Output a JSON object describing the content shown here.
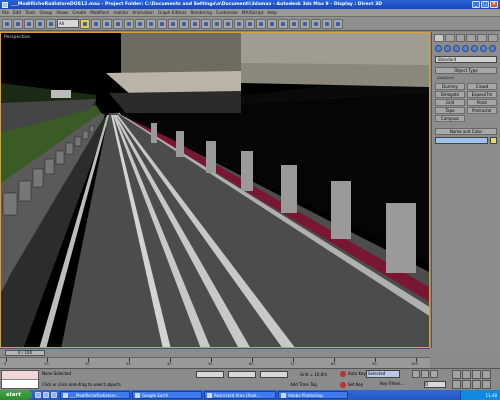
{
  "window": {
    "title": "___ModifiicheRadiatoreDOS12.max - Project Folder: C:\\Documents and Settings\\a\\Documenti\\3dsmax - Autodesk 3ds Max 9 - Display : Direct 3D",
    "buttons": {
      "minimize": "_",
      "maximize": "□",
      "close": "×"
    }
  },
  "menu": [
    "File",
    "Edit",
    "Tools",
    "Group",
    "Views",
    "Create",
    "Modifiers",
    "reactor",
    "Animation",
    "Graph Editors",
    "Rendering",
    "Customize",
    "MAXScript",
    "Help"
  ],
  "toolbar": {
    "selection_filter": "All"
  },
  "viewport": {
    "label": "Perspective"
  },
  "command_panel": {
    "dropdown": "Standard",
    "object_type_header": "Object Type",
    "autogrid": "AutoGrid",
    "buttons": [
      "Dummy",
      "Crowd",
      "Delegate",
      "ExposeTm",
      "Grid",
      "Point",
      "Tape",
      "Protractor",
      "Compass"
    ],
    "name_color_header": "Name and Color"
  },
  "timeline": {
    "frame_display": "0 / 100",
    "ticks": [
      "0",
      "10",
      "20",
      "30",
      "40",
      "50",
      "60",
      "70",
      "80",
      "90",
      "100"
    ]
  },
  "status": {
    "selection": "None Selected",
    "prompt": "Click or click-and-drag to select objects",
    "grid": "Grid = 10,0m",
    "add_time_tag": "Add Time Tag",
    "auto_key": "Auto Key",
    "set_key": "Set Key",
    "selected": "Selected",
    "key_filters": "Key Filters...",
    "frame": "0"
  },
  "taskbar": {
    "start": "start",
    "tasks": [
      "___ModifiicheRadiatore...",
      "Google Earth",
      "Restricted Area (Radi...",
      "Adobe Photoshop"
    ],
    "clock": "11.48"
  },
  "colors": {
    "titlebar": "#2a63d6",
    "road": "#4d4d4d",
    "curb_red": "#7a1635",
    "viewport_border": "#e0a030"
  }
}
